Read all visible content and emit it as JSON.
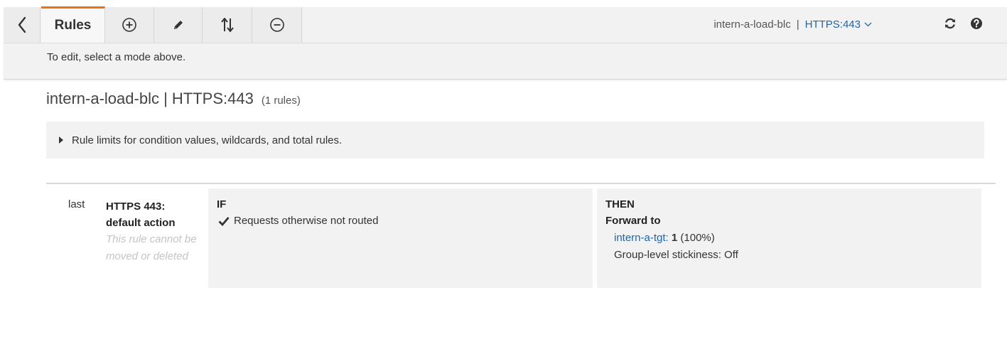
{
  "toolbar": {
    "rules_tab_label": "Rules",
    "listener": {
      "load_balancer": "intern-a-load-blc",
      "separator": "|",
      "protocol": "HTTPS:443"
    },
    "icons": [
      "back-icon",
      "add-icon",
      "edit-icon",
      "reorder-icon",
      "delete-icon",
      "chevron-down-icon",
      "refresh-icon",
      "help-icon"
    ]
  },
  "info_bar": {
    "message": "To edit, select a mode above."
  },
  "heading": {
    "title": "intern-a-load-blc | HTTPS:443",
    "count": "(1 rules)"
  },
  "limits_panel": {
    "label": "Rule limits for condition values, wildcards, and total rules."
  },
  "rules": [
    {
      "priority": "last",
      "name": "HTTPS 443: default action",
      "note": "This rule cannot be moved or deleted",
      "condition": {
        "heading": "IF",
        "items": [
          "Requests otherwise not routed"
        ]
      },
      "action": {
        "heading": "THEN",
        "type": "Forward to",
        "target_group": "intern-a-tgt",
        "target_suffix": ":",
        "weight": "1",
        "weight_percent": "(100%)",
        "stickiness": "Group-level stickiness: Off"
      }
    }
  ],
  "colors": {
    "accent_tab": "#ec7211",
    "link": "#1a66b0",
    "panel_bg": "#f2f2f2",
    "muted_text": "#c4c4c4"
  }
}
